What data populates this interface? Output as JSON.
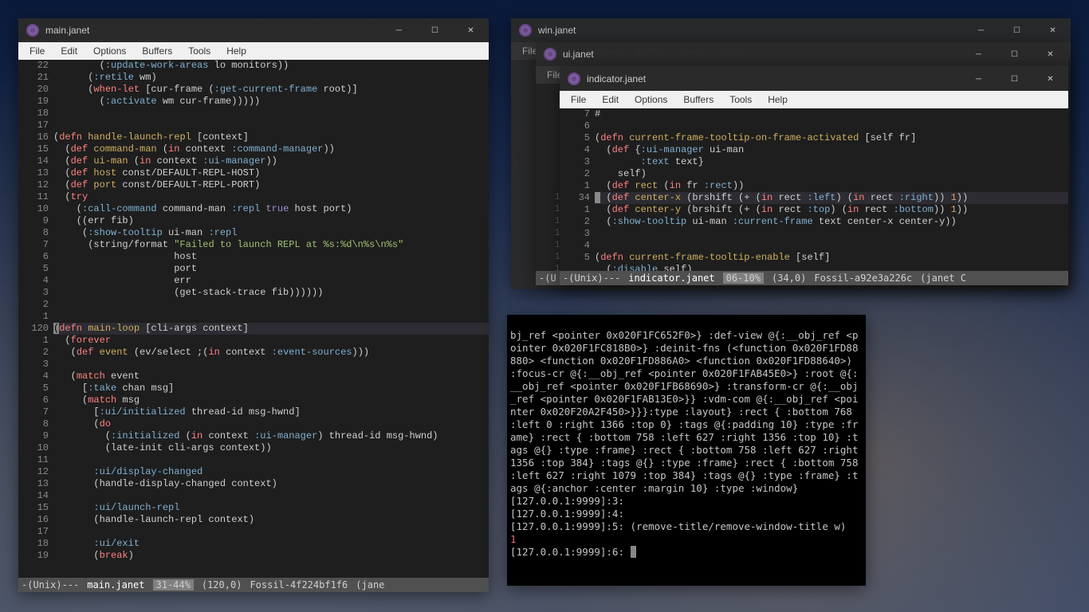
{
  "menus": [
    "File",
    "Edit",
    "Options",
    "Buffers",
    "Tools",
    "Help"
  ],
  "main_win": {
    "title": "main.janet",
    "gutter": " 22\n 21\n 20\n 19\n 18\n 17\n 16\n 15\n 14\n 13\n 12\n 11\n 10\n  9\n  8\n  7\n  6\n  5\n  4\n  3\n  2\n  1\n120\n  1\n  2\n  3\n  4\n  5\n  6\n  7\n  8\n  9\n 10\n 11\n 12\n 13\n 14\n 15\n 16\n 17\n 18\n 19",
    "status": {
      "mode": "-(Unix)---",
      "file": "main.janet",
      "pct": "31-44%",
      "pos": "(120,0)",
      "vcs": "Fossil-4f224bf1f6",
      "lang": "(jane"
    }
  },
  "win_win": {
    "title": "win.janet"
  },
  "ui_win": {
    "title": "ui.janet"
  },
  "indicator_win": {
    "title": "indicator.janet",
    "gutter": "  7\n  6\n  5\n  4\n  3\n  2\n  1\n 34\n  1\n  2\n  3\n  4\n  5",
    "status": {
      "mode": "-(Unix)---",
      "file": "indicator.janet",
      "pct": "06-10%",
      "pos": "(34,0)",
      "vcs": "Fossil-a92e3a226c",
      "lang": "(janet C"
    }
  },
  "terminal_text": "bj_ref <pointer 0x020F1FC652F0>} :def-view @{:__obj_ref <pointer 0x020F1FC818B0>} :deinit-fns (<function 0x020F1FD88880> <function 0x020F1FD886A0> <function 0x020F1FD88640>) :focus-cr @{:__obj_ref <pointer 0x020F1FAB45E0>} :root @{:__obj_ref <pointer 0x020F1FB68690>} :transform-cr @{:__obj_ref <pointer 0x020F1FAB13E0>}} :vdm-com @{:__obj_ref <pointer 0x020F20A2F450>}}}:type :layout} :rect { :bottom 768 :left 0 :right 1366 :top 0} :tags @{:padding 10} :type :frame} :rect { :bottom 758 :left 627 :right 1356 :top 10} :tags @{} :type :frame} :rect { :bottom 758 :left 627 :right 1356 :top 384} :tags @{} :type :frame} :rect { :bottom 758 :left 627 :right 1079 :top 384} :tags @{} :type :frame} :tags @{:anchor :center :margin 10} :type :window}\n[127.0.0.1:9999]:3:\n[127.0.0.1:9999]:4:\n[127.0.0.1:9999]:5: (remove-title/remove-window-title w)\n",
  "terminal_result": "1",
  "terminal_prompt": "[127.0.0.1:9999]:6: "
}
